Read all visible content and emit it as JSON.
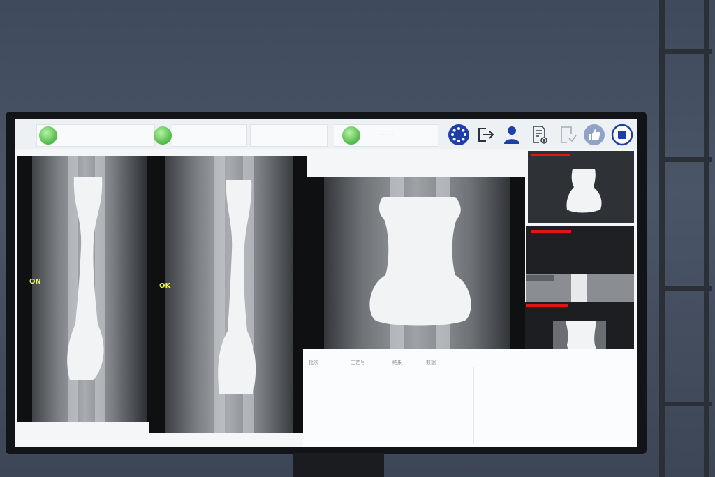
{
  "toolbar": {
    "field_2": "",
    "field_3": "",
    "field_4": "··· ···",
    "indicators": [
      "green",
      "green",
      "green"
    ],
    "icons": [
      "settings-wheel-icon",
      "logout-icon",
      "user-icon",
      "document-settings-icon",
      "save-document-icon",
      "thumbs-up-icon",
      "stop-icon"
    ],
    "accent_color": "#1f3fa8"
  },
  "panels": {
    "left_status": "ON",
    "middle_status": "OK"
  },
  "table": {
    "headers": [
      "批次",
      "工艺号",
      "结果",
      "数据"
    ]
  }
}
